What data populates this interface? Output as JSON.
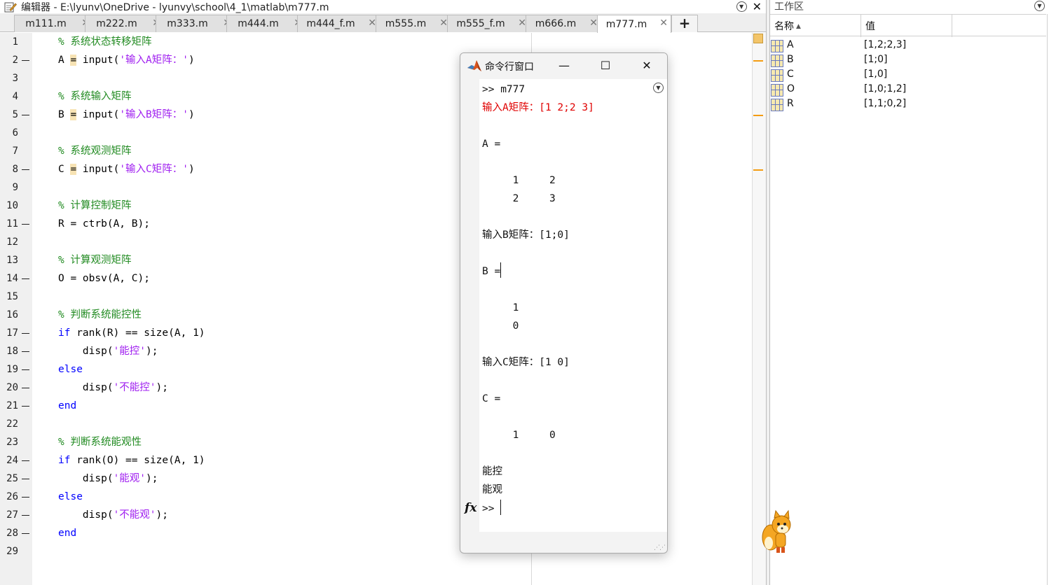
{
  "editor": {
    "title": "编辑器 - E:\\lyunv\\OneDrive - lyunvy\\school\\4_1\\matlab\\m777.m",
    "tabs": [
      {
        "label": "m111.m"
      },
      {
        "label": "m222.m"
      },
      {
        "label": "m333.m"
      },
      {
        "label": "m444.m"
      },
      {
        "label": "m444_f.m"
      },
      {
        "label": "m555.m"
      },
      {
        "label": "m555_f.m"
      },
      {
        "label": "m666.m"
      },
      {
        "label": "m777.m"
      }
    ],
    "tab_close": "✕",
    "add_tab": "+",
    "line_numbers": [
      "1",
      "2",
      "3",
      "4",
      "5",
      "6",
      "7",
      "8",
      "9",
      "10",
      "11",
      "12",
      "13",
      "14",
      "15",
      "16",
      "17",
      "18",
      "19",
      "20",
      "21",
      "22",
      "23",
      "24",
      "25",
      "26",
      "27",
      "28",
      "29"
    ],
    "code": {
      "l1": "% 系统状态转移矩阵",
      "l2_var": "A ",
      "l2_eq": "=",
      "l2_fn": " input(",
      "l2_str": "'输入A矩阵：'",
      "l2_end": ")",
      "l4": "% 系统输入矩阵",
      "l5_var": "B ",
      "l5_eq": "=",
      "l5_fn": " input(",
      "l5_str": "'输入B矩阵：'",
      "l5_end": ")",
      "l7": "% 系统观测矩阵",
      "l8_var": "C ",
      "l8_eq": "=",
      "l8_fn": " input(",
      "l8_str": "'输入C矩阵：'",
      "l8_end": ")",
      "l10": "% 计算控制矩阵",
      "l11": "R = ctrb(A, B);",
      "l13": "% 计算观测矩阵",
      "l14": "O = obsv(A, C);",
      "l16": "% 判断系统能控性",
      "l17_kw": "if",
      "l17_rest": " rank(R) == size(A, 1)",
      "l18_a": "    disp(",
      "l18_str": "'能控'",
      "l18_b": ");",
      "l19": "else",
      "l20_a": "    disp(",
      "l20_str": "'不能控'",
      "l20_b": ");",
      "l21": "end",
      "l23": "% 判断系统能观性",
      "l24_kw": "if",
      "l24_rest": " rank(O) == size(A, 1)",
      "l25_a": "    disp(",
      "l25_str": "'能观'",
      "l25_b": ");",
      "l26": "else",
      "l27_a": "    disp(",
      "l27_str": "'不能观'",
      "l27_b": ");",
      "l28": "end"
    }
  },
  "workspace": {
    "title": "工作区",
    "col_name": "名称",
    "col_value": "值",
    "sort_arrow": "▲",
    "vars": [
      {
        "name": "A",
        "value": "[1,2;2,3]"
      },
      {
        "name": "B",
        "value": "[1;0]"
      },
      {
        "name": "C",
        "value": "[1,0]"
      },
      {
        "name": "O",
        "value": "[1,0;1,2]"
      },
      {
        "name": "R",
        "value": "[1,1;0,2]"
      }
    ]
  },
  "command_window": {
    "title": "命令行窗口",
    "minimize": "—",
    "maximize": "☐",
    "close": "✕",
    "fx": "fx",
    "lines": {
      "cmd": ">> m777",
      "inA": "输入A矩阵：[1 2;2 3]",
      "A_eq": "A =",
      "A_r1": "     1     2",
      "A_r2": "     2     3",
      "inB": "输入B矩阵：[1;0]",
      "B_eq": "B =",
      "B_r1": "     1",
      "B_r2": "     0",
      "inC": "输入C矩阵：[1 0]",
      "C_eq": "C =",
      "C_r1": "     1     0",
      "out1": "能控",
      "out2": "能观",
      "prompt": ">> "
    }
  },
  "colors": {
    "comment": "#228b22",
    "keyword": "#0000ff",
    "string": "#a020f0",
    "error": "#e00000",
    "marker": "#f39c12"
  }
}
